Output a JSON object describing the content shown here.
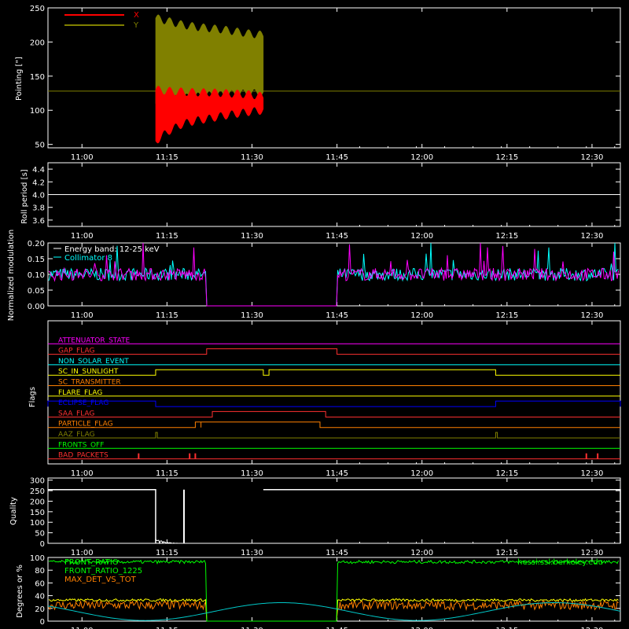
{
  "colors": {
    "background": "#000000",
    "axes": "#ffffff",
    "pointing_x": "#ff0000",
    "pointing_y": "#808000",
    "modulation_band": "#ffffff",
    "modulation_collimator": "#00ffff",
    "modulation_magenta": "#ff00ff",
    "quality": "#ffffff",
    "front_ratio": "#00ff00",
    "front_ratio_1225": "#ffff00",
    "max_det_vs_tot": "#ff8000",
    "angle_curve": "#00c8c8",
    "watermark": "#00ff00"
  },
  "time_ticks": [
    "11:00",
    "11:15",
    "11:30",
    "11:45",
    "12:00",
    "12:15",
    "12:30"
  ],
  "watermark": "hessi.ssl.berkeley.edu",
  "chart_data": [
    {
      "id": "pointing",
      "type": "line",
      "ylabel": "Pointing [\"]",
      "ylim": [
        45,
        250
      ],
      "yticks": [
        "50",
        "100",
        "150",
        "200",
        "250"
      ],
      "legend_placement": "top-left",
      "series": [
        {
          "name": "X",
          "color": "#ff0000",
          "segment_start": "11:13",
          "segment_end": "11:32",
          "envelope_low": [
            55,
            70,
            80,
            85,
            88,
            92,
            95,
            98,
            100
          ],
          "envelope_high": [
            130,
            128,
            127,
            126,
            126,
            125,
            124,
            123,
            120
          ]
        },
        {
          "name": "Y",
          "color": "#808000",
          "segment_start": "11:13",
          "segment_end": "11:32",
          "envelope_low": [
            110,
            115,
            118,
            120,
            122,
            123,
            124,
            125,
            125
          ],
          "envelope_high": [
            235,
            230,
            225,
            222,
            220,
            218,
            215,
            212,
            210
          ]
        }
      ],
      "reference_level": 128
    },
    {
      "id": "roll",
      "type": "line",
      "ylabel": "Roll period [s]",
      "ylim": [
        3.5,
        4.5
      ],
      "yticks": [
        "3.6",
        "3.8",
        "4.0",
        "4.2",
        "4.4"
      ],
      "series": [
        {
          "name": "",
          "value": 4.0
        }
      ]
    },
    {
      "id": "modulation",
      "type": "line",
      "ylabel": "Normalized modulation",
      "ylim": [
        0.0,
        0.2
      ],
      "yticks": [
        "0.00",
        "0.05",
        "0.10",
        "0.15",
        "0.20"
      ],
      "annotations": [
        "Energy band: 12-25 keV",
        "Collimator 8"
      ],
      "data_gaps": [
        [
          "11:22",
          "11:45"
        ]
      ],
      "typical_level": 0.1
    },
    {
      "id": "flags",
      "type": "line",
      "ylabel": "Flags",
      "flags": [
        {
          "name": "ATTENUATOR_STATE",
          "color": "#ff00ff",
          "on_intervals": []
        },
        {
          "name": "GAP_FLAG",
          "color": "#ff3030",
          "on_intervals": [
            [
              "11:22",
              "11:45"
            ]
          ]
        },
        {
          "name": "NON_SOLAR_EVENT",
          "color": "#00ffff",
          "on_intervals": []
        },
        {
          "name": "SC_IN_SUNLIGHT",
          "color": "#ffff00",
          "on_intervals": [
            [
              "11:13",
              "11:32"
            ],
            [
              "11:33",
              "12:13"
            ]
          ]
        },
        {
          "name": "SC_TRANSMITTER",
          "color": "#ff8000",
          "on_intervals": []
        },
        {
          "name": "FLARE_FLAG",
          "color": "#ffff00",
          "on_intervals": []
        },
        {
          "name": "ECLIPSE_FLAG",
          "color": "#0000ff",
          "on_intervals": [
            [
              "10:54",
              "11:13"
            ],
            [
              "12:13",
              "12:35"
            ]
          ]
        },
        {
          "name": "SAA_FLAG",
          "color": "#ff3030",
          "on_intervals": [
            [
              "11:23",
              "11:43"
            ]
          ]
        },
        {
          "name": "PARTICLE_FLAG",
          "color": "#ff8000",
          "on_intervals": [
            [
              "11:20",
              "11:21"
            ],
            [
              "11:21",
              "11:42"
            ]
          ]
        },
        {
          "name": "AAZ_FLAG",
          "color": "#808000",
          "on_intervals": [
            [
              "11:13",
              "11:13.3"
            ],
            [
              "12:13",
              "12:13.3"
            ]
          ]
        },
        {
          "name": "FRONTS_OFF",
          "color": "#00ff00",
          "on_intervals": []
        },
        {
          "name": "BAD_PACKETS",
          "color": "#ff3030",
          "spikes": [
            "11:10",
            "11:19",
            "11:20",
            "12:29",
            "12:31"
          ]
        }
      ]
    },
    {
      "id": "quality",
      "type": "line",
      "ylabel": "Quality",
      "ylim": [
        0,
        310
      ],
      "yticks": [
        "0",
        "50",
        "100",
        "150",
        "200",
        "250",
        "300"
      ],
      "segments": [
        {
          "start": "10:54",
          "end": "11:13",
          "value": 255
        },
        {
          "start": "11:32",
          "end": "12:35",
          "value": 255
        }
      ],
      "spike": {
        "time": "11:18",
        "value": 255
      }
    },
    {
      "id": "ratios",
      "type": "line",
      "ylabel": "Degrees or %",
      "ylim": [
        0,
        100
      ],
      "yticks": [
        "0",
        "20",
        "40",
        "60",
        "80",
        "100"
      ],
      "legend_placement": "top-left",
      "series": [
        {
          "name": "FRONT_RATIO",
          "color": "#00ff00",
          "typical": 93
        },
        {
          "name": "FRONT_RATIO_1225",
          "color": "#ffff00",
          "typical": 33
        },
        {
          "name": "MAX_DET_VS_TOT",
          "color": "#ff8000",
          "typical": 25
        }
      ],
      "data_gaps": [
        [
          "11:22",
          "11:45"
        ]
      ]
    }
  ]
}
